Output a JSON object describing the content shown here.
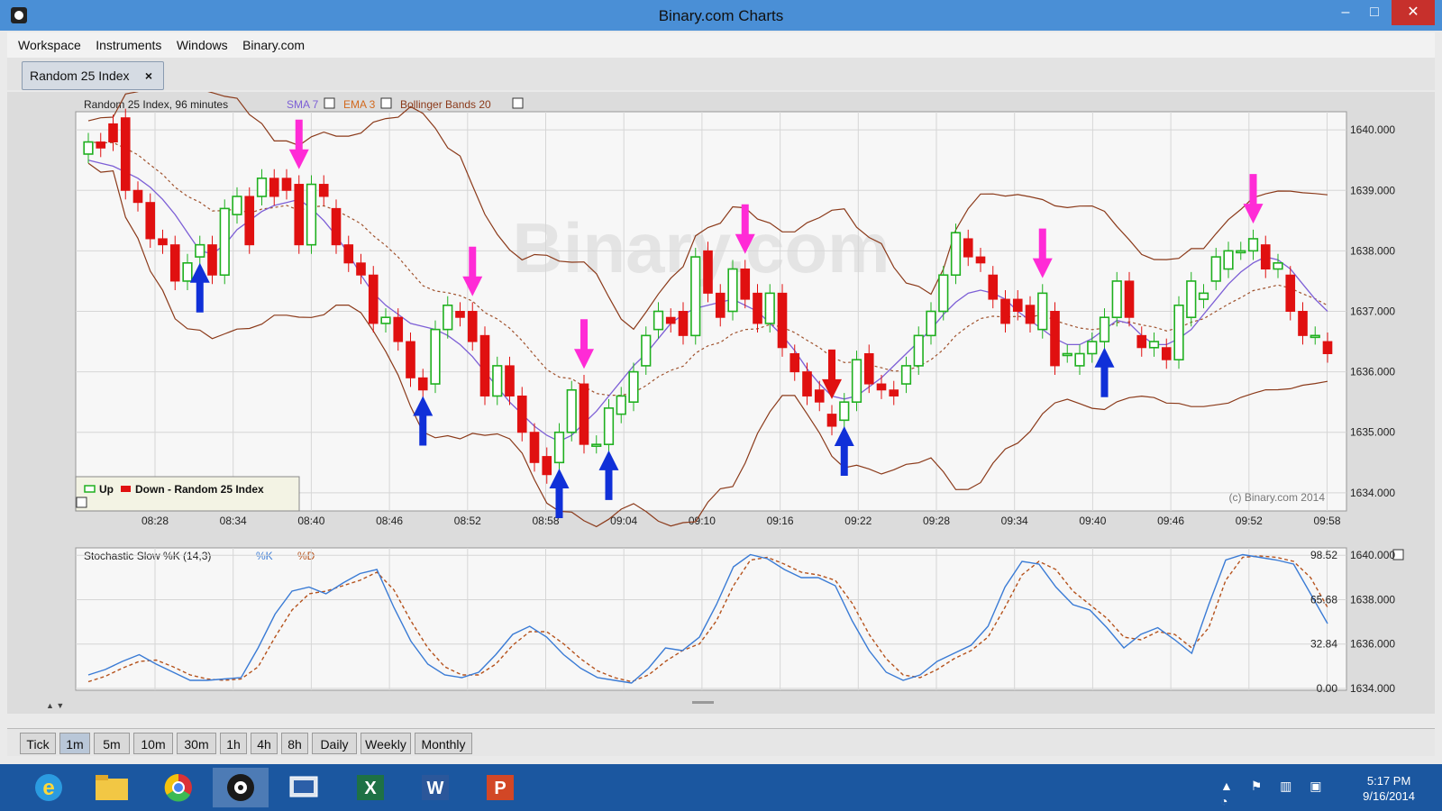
{
  "window": {
    "title": "Binary.com Charts",
    "minimize": "–",
    "maximize": "□",
    "close": "✕"
  },
  "menu": [
    "Workspace",
    "Instruments",
    "Windows",
    "Binary.com"
  ],
  "tab": {
    "label": "Random 25 Index",
    "close": "×"
  },
  "price_chart": {
    "header": "Random 25 Index, 96 minutes",
    "indicators": [
      {
        "label": "SMA 7",
        "color": "#7d5fd6"
      },
      {
        "label": "EMA 3",
        "color": "#d2691e"
      },
      {
        "label": "Bollinger Bands 20",
        "color": "#8b3a1a"
      }
    ],
    "legend": {
      "up": "Up",
      "down": "Down - Random 25 Index"
    },
    "copyright": "(c) Binary.com 2014",
    "watermark": "Binary.com"
  },
  "chart_data": [
    {
      "type": "candlestick",
      "title": "Random 25 Index, 96 minutes",
      "x_ticks": [
        "08:28",
        "08:34",
        "08:40",
        "08:46",
        "08:52",
        "08:58",
        "09:04",
        "09:10",
        "09:16",
        "09:22",
        "09:28",
        "09:34",
        "09:40",
        "09:46",
        "09:52",
        "09:58"
      ],
      "y_ticks": [
        "1640.000",
        "1639.000",
        "1638.000",
        "1637.000",
        "1636.000",
        "1635.000",
        "1634.000"
      ],
      "ylim": [
        1633.7,
        1640.3
      ],
      "series_legend": [
        "Up",
        "Down - Random 25 Index"
      ],
      "colors": {
        "up": "#1fb01f",
        "down": "#e01010"
      },
      "candles_oc": [
        [
          1639.6,
          1639.8
        ],
        [
          1639.8,
          1639.7
        ],
        [
          1640.1,
          1639.8
        ],
        [
          1640.2,
          1639.0
        ],
        [
          1639.0,
          1638.8
        ],
        [
          1638.8,
          1638.2
        ],
        [
          1638.2,
          1638.1
        ],
        [
          1638.1,
          1637.5
        ],
        [
          1637.5,
          1637.8
        ],
        [
          1637.9,
          1638.1
        ],
        [
          1638.1,
          1637.6
        ],
        [
          1637.6,
          1638.7
        ],
        [
          1638.6,
          1638.9
        ],
        [
          1638.9,
          1638.1
        ],
        [
          1638.9,
          1639.2
        ],
        [
          1639.2,
          1638.9
        ],
        [
          1639.2,
          1639.0
        ],
        [
          1639.1,
          1638.1
        ],
        [
          1638.1,
          1639.1
        ],
        [
          1639.1,
          1638.9
        ],
        [
          1638.7,
          1638.1
        ],
        [
          1638.1,
          1637.8
        ],
        [
          1637.8,
          1637.6
        ],
        [
          1637.6,
          1636.8
        ],
        [
          1636.8,
          1636.9
        ],
        [
          1636.9,
          1636.5
        ],
        [
          1636.5,
          1635.9
        ],
        [
          1635.9,
          1635.7
        ],
        [
          1635.8,
          1636.7
        ],
        [
          1636.7,
          1637.1
        ],
        [
          1637.0,
          1636.9
        ],
        [
          1637.0,
          1636.5
        ],
        [
          1636.6,
          1635.6
        ],
        [
          1635.6,
          1636.1
        ],
        [
          1636.1,
          1635.6
        ],
        [
          1635.6,
          1635.0
        ],
        [
          1635.0,
          1634.5
        ],
        [
          1634.6,
          1634.3
        ],
        [
          1634.5,
          1635.0
        ],
        [
          1635.0,
          1635.7
        ],
        [
          1635.8,
          1634.8
        ],
        [
          1634.8,
          1634.8
        ],
        [
          1634.8,
          1635.4
        ],
        [
          1635.3,
          1635.6
        ],
        [
          1635.5,
          1636.0
        ],
        [
          1636.1,
          1636.6
        ],
        [
          1636.7,
          1637.0
        ],
        [
          1636.9,
          1636.8
        ],
        [
          1637.0,
          1636.6
        ],
        [
          1636.6,
          1637.9
        ],
        [
          1638.0,
          1637.3
        ],
        [
          1637.3,
          1636.9
        ],
        [
          1637.0,
          1637.7
        ],
        [
          1637.7,
          1637.2
        ],
        [
          1637.3,
          1636.8
        ],
        [
          1636.8,
          1637.3
        ],
        [
          1637.3,
          1636.4
        ],
        [
          1636.3,
          1636.0
        ],
        [
          1636.0,
          1635.6
        ],
        [
          1635.7,
          1635.5
        ],
        [
          1635.3,
          1635.1
        ],
        [
          1635.2,
          1635.5
        ],
        [
          1635.5,
          1636.2
        ],
        [
          1636.3,
          1635.8
        ],
        [
          1635.8,
          1635.7
        ],
        [
          1635.7,
          1635.6
        ],
        [
          1635.8,
          1636.1
        ],
        [
          1636.1,
          1636.6
        ],
        [
          1636.6,
          1637.0
        ],
        [
          1637.0,
          1637.6
        ],
        [
          1637.6,
          1638.3
        ],
        [
          1638.2,
          1637.9
        ],
        [
          1637.9,
          1637.8
        ],
        [
          1637.6,
          1637.2
        ],
        [
          1637.2,
          1636.8
        ],
        [
          1637.2,
          1637.0
        ],
        [
          1637.1,
          1636.8
        ],
        [
          1636.7,
          1637.3
        ],
        [
          1637.0,
          1636.1
        ],
        [
          1636.3,
          1636.3
        ],
        [
          1636.1,
          1636.3
        ],
        [
          1636.3,
          1636.5
        ],
        [
          1636.5,
          1636.9
        ],
        [
          1636.9,
          1637.5
        ],
        [
          1637.5,
          1636.9
        ],
        [
          1636.6,
          1636.4
        ],
        [
          1636.4,
          1636.5
        ],
        [
          1636.4,
          1636.2
        ],
        [
          1636.2,
          1637.1
        ],
        [
          1636.9,
          1637.5
        ],
        [
          1637.2,
          1637.3
        ],
        [
          1637.5,
          1637.9
        ],
        [
          1637.7,
          1638.0
        ],
        [
          1638.0,
          1638.0
        ],
        [
          1638.0,
          1638.2
        ],
        [
          1638.1,
          1637.7
        ],
        [
          1637.7,
          1637.8
        ],
        [
          1637.6,
          1637.0
        ],
        [
          1637.0,
          1636.6
        ],
        [
          1636.6,
          1636.6
        ],
        [
          1636.5,
          1636.3
        ]
      ],
      "sma7": [
        1639.5,
        1639.45,
        1639.4,
        1639.3,
        1639.2,
        1639.05,
        1638.85,
        1638.6,
        1638.3,
        1638.0,
        1637.95,
        1638.1,
        1638.35,
        1638.5,
        1638.65,
        1638.75,
        1638.8,
        1638.85,
        1638.7,
        1638.5,
        1638.25,
        1637.95,
        1637.6,
        1637.3,
        1637.1,
        1636.95,
        1636.8,
        1636.75,
        1636.7,
        1636.6,
        1636.45,
        1636.25,
        1636.0,
        1635.75,
        1635.5,
        1635.3,
        1635.1,
        1634.95,
        1634.85,
        1634.95,
        1635.15,
        1635.35,
        1635.6,
        1635.85,
        1636.1,
        1636.3,
        1636.55,
        1636.8,
        1636.95,
        1637.05,
        1637.1,
        1637.15,
        1637.2,
        1637.1,
        1637.0,
        1636.8,
        1636.6,
        1636.35,
        1636.05,
        1635.8,
        1635.6,
        1635.55,
        1635.6,
        1635.75,
        1635.9,
        1636.1,
        1636.3,
        1636.5,
        1636.7,
        1636.95,
        1637.15,
        1637.3,
        1637.35,
        1637.3,
        1637.2,
        1637.0,
        1636.85,
        1636.7,
        1636.55,
        1636.45,
        1636.45,
        1636.55,
        1636.7,
        1636.85,
        1636.8,
        1636.6,
        1636.45,
        1636.45,
        1636.55,
        1636.7,
        1636.95,
        1637.2,
        1637.45,
        1637.65,
        1637.8,
        1637.9,
        1637.85,
        1637.7,
        1637.45,
        1637.2,
        1637.0
      ]
    },
    {
      "type": "line",
      "title": "Stochastic Slow %K (14,3)",
      "series": [
        {
          "name": "%K",
          "color": "#3a7bd5"
        },
        {
          "name": "%D",
          "color": "#b5521c"
        }
      ],
      "right_values": [
        "98.52",
        "65.68",
        "32.84",
        "0.00"
      ],
      "right_ticks": [
        "1640.000",
        "1638.000",
        "1636.000",
        "1634.000"
      ],
      "ylim": [
        0,
        100
      ],
      "k": [
        10,
        14,
        20,
        25,
        18,
        12,
        6,
        6,
        7,
        8,
        30,
        55,
        72,
        75,
        70,
        78,
        85,
        88,
        60,
        35,
        18,
        10,
        8,
        12,
        25,
        40,
        46,
        38,
        25,
        15,
        8,
        6,
        4,
        15,
        30,
        28,
        38,
        62,
        90,
        99,
        96,
        88,
        82,
        82,
        76,
        50,
        28,
        12,
        6,
        10,
        20,
        26,
        32,
        46,
        75,
        94,
        92,
        75,
        62,
        58,
        45,
        30,
        40,
        45,
        36,
        26,
        62,
        95,
        99,
        97,
        95,
        92,
        70,
        48
      ],
      "d": [
        5,
        9,
        15,
        20,
        21,
        16,
        10,
        7,
        6,
        7,
        16,
        38,
        58,
        70,
        72,
        76,
        80,
        86,
        73,
        50,
        30,
        16,
        10,
        10,
        18,
        32,
        42,
        42,
        33,
        22,
        13,
        8,
        5,
        10,
        20,
        28,
        33,
        50,
        76,
        95,
        97,
        92,
        86,
        84,
        80,
        63,
        40,
        22,
        10,
        8,
        14,
        22,
        28,
        38,
        60,
        84,
        94,
        88,
        72,
        62,
        52,
        38,
        36,
        42,
        40,
        30,
        45,
        80,
        97,
        98,
        97,
        94,
        82,
        60
      ]
    }
  ],
  "stochastic": {
    "header": "Stochastic Slow %K (14,3)",
    "k_label": "%K",
    "d_label": "%D"
  },
  "periods": [
    {
      "label": "Tick",
      "active": false
    },
    {
      "label": "1m",
      "active": true
    },
    {
      "label": "5m",
      "active": false
    },
    {
      "label": "10m",
      "active": false
    },
    {
      "label": "30m",
      "active": false
    },
    {
      "label": "1h",
      "active": false
    },
    {
      "label": "4h",
      "active": false
    },
    {
      "label": "8h",
      "active": false
    },
    {
      "label": "Daily",
      "active": false
    },
    {
      "label": "Weekly",
      "active": false
    },
    {
      "label": "Monthly",
      "active": false
    }
  ],
  "taskbar": {
    "apps": [
      "internet-explorer-icon",
      "file-explorer-icon",
      "chrome-icon",
      "binary-charts-icon",
      "remote-desktop-icon",
      "excel-icon",
      "word-icon",
      "powerpoint-icon"
    ],
    "clock_time": "5:17 PM",
    "clock_date": "9/16/2014",
    "tray_glyphs": "▲ ⚑ ▥ ▣ ◔"
  }
}
